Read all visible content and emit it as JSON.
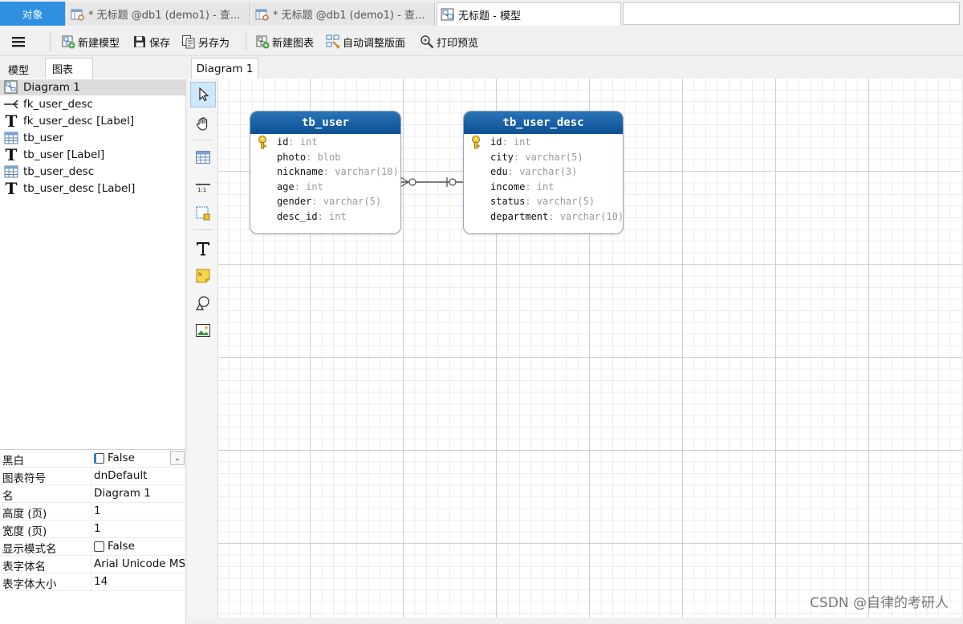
{
  "tabs": [
    {
      "label": "对象"
    },
    {
      "label": "* 无标题 @db1 (demo1) - 查..."
    },
    {
      "label": "* 无标题 @db1 (demo1) - 查..."
    },
    {
      "label": "无标题 - 模型"
    }
  ],
  "toolbar": {
    "new_model": "新建模型",
    "save": "保存",
    "save_as": "另存为",
    "new_diagram": "新建图表",
    "auto_layout": "自动调整版面",
    "print_preview": "打印预览"
  },
  "left_tabs": {
    "model": "模型",
    "diagram": "图表"
  },
  "tree": [
    {
      "label": "Diagram 1",
      "icon": "diagram-icon"
    },
    {
      "label": "fk_user_desc",
      "icon": "relation-icon"
    },
    {
      "label": "fk_user_desc [Label]",
      "icon": "text-icon"
    },
    {
      "label": "tb_user",
      "icon": "table-icon"
    },
    {
      "label": "tb_user [Label]",
      "icon": "text-icon"
    },
    {
      "label": "tb_user_desc",
      "icon": "table-icon"
    },
    {
      "label": "tb_user_desc [Label]",
      "icon": "text-icon"
    }
  ],
  "properties": [
    {
      "key": "黑白",
      "value": "False"
    },
    {
      "key": "图表符号",
      "value": "dnDefault"
    },
    {
      "key": "名",
      "value": "Diagram 1"
    },
    {
      "key": "高度 (页)",
      "value": "1"
    },
    {
      "key": "宽度 (页)",
      "value": "1"
    },
    {
      "key": "显示模式名",
      "value": "False"
    },
    {
      "key": "表字体名",
      "value": "Arial Unicode MS"
    },
    {
      "key": "表字体大小",
      "value": "14"
    }
  ],
  "doc_tab": "Diagram 1",
  "entities": {
    "tb_user": {
      "name": "tb_user",
      "fields": [
        {
          "name": "id",
          "type": ": int"
        },
        {
          "name": "photo",
          "type": ": blob"
        },
        {
          "name": "nickname",
          "type": ": varchar(10)"
        },
        {
          "name": "age",
          "type": ": int"
        },
        {
          "name": "gender",
          "type": ": varchar(5)"
        },
        {
          "name": "desc_id",
          "type": ": int"
        }
      ]
    },
    "tb_user_desc": {
      "name": "tb_user_desc",
      "fields": [
        {
          "name": "id",
          "type": ": int"
        },
        {
          "name": "city",
          "type": ": varchar(5)"
        },
        {
          "name": "edu",
          "type": ": varchar(3)"
        },
        {
          "name": "income",
          "type": ": int"
        },
        {
          "name": "status",
          "type": ": varchar(5)"
        },
        {
          "name": "department",
          "type": ": varchar(10)"
        }
      ]
    }
  },
  "watermark": "CSDN @自律的考研人",
  "colors": {
    "accent": "#2f8fe0",
    "entity_header": "#0c4f93"
  }
}
